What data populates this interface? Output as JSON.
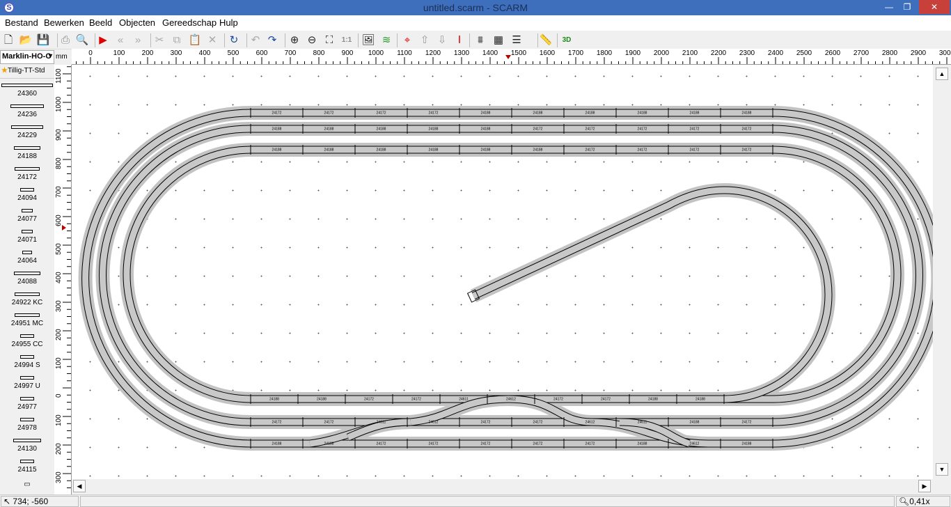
{
  "window": {
    "title": "untitled.scarm",
    "app": "SCARM",
    "title_full": "untitled.scarm - SCARM"
  },
  "menu": [
    "Bestand",
    "Bewerken",
    "Beeld",
    "Objecten",
    "Gereedschap",
    "Hulp"
  ],
  "toolbar": [
    "new-file",
    "open-folder",
    "save",
    "print",
    "print-preview",
    "run",
    "rewind",
    "fast-forward",
    "cut",
    "copy",
    "paste",
    "delete",
    "rotate",
    "undo",
    "redo",
    "zoom-in",
    "zoom-out",
    "fit",
    "zoom-1-1",
    "background-image",
    "layers",
    "height-tool",
    "raise",
    "lower",
    "height-marker",
    "bridge",
    "tunnel",
    "track-lines",
    "measure",
    "3D"
  ],
  "toolbar_labels": {
    "zoom_1_1": "1:1",
    "view3d": "3D"
  },
  "library": {
    "selected": "Marklin-HO-C",
    "favorite": "Tillig-TT-Std",
    "unit": "mm"
  },
  "parts": [
    "24360",
    "24236",
    "24229",
    "24188",
    "24172",
    "24094",
    "24077",
    "24071",
    "24064",
    "24088",
    "24922 KC",
    "24951 MC",
    "24955 CC",
    "24994 S",
    "24997 U",
    "24977",
    "24978",
    "24130",
    "24115"
  ],
  "hruler": [
    "0",
    "100",
    "200",
    "300",
    "400",
    "500",
    "600",
    "700",
    "800",
    "900",
    "1000",
    "1100",
    "1200",
    "1300",
    "1400",
    "1500",
    "1600",
    "1700",
    "1800",
    "1900",
    "2000",
    "2100",
    "2200",
    "2300",
    "2400",
    "2500",
    "2600",
    "2700",
    "2800",
    "2900",
    "3000"
  ],
  "vruler": [
    "1100",
    "1000",
    "900",
    "800",
    "700",
    "600",
    "500",
    "400",
    "300",
    "200",
    "100",
    "0",
    "100",
    "200",
    "300"
  ],
  "tracks": {
    "outer_top": [
      "24172",
      "24172",
      "24172",
      "24172",
      "24188",
      "24188",
      "24188",
      "24188",
      "24188",
      "24188"
    ],
    "middle_top": [
      "24188",
      "24188",
      "24188",
      "24188",
      "24188",
      "24172",
      "24172",
      "24172",
      "24172",
      "24172"
    ],
    "inner_top": [
      "24188",
      "24188",
      "24188",
      "24188",
      "24188",
      "24188",
      "24172",
      "24172",
      "24172",
      "24172"
    ],
    "inner_bottom": [
      "24188",
      "24188",
      "24172",
      "24172",
      "24611",
      "24612",
      "24172",
      "24172",
      "24188",
      "24188"
    ],
    "middle_bottom": [
      "24172",
      "24172",
      "24611",
      "24612",
      "24172",
      "24172",
      "24612",
      "24611",
      "24188",
      "24172"
    ],
    "outer_bottom": [
      "24188",
      "24188",
      "24172",
      "24172",
      "24172",
      "24172",
      "24172",
      "24188",
      "24612",
      "24188"
    ]
  },
  "colors": {
    "titlebar": "#3d6fbd",
    "track_bed": "#c3c3c3",
    "rail": "#000000",
    "close": "#c7403a"
  },
  "status": {
    "coords": "734; -560",
    "zoom": "0,41x"
  }
}
